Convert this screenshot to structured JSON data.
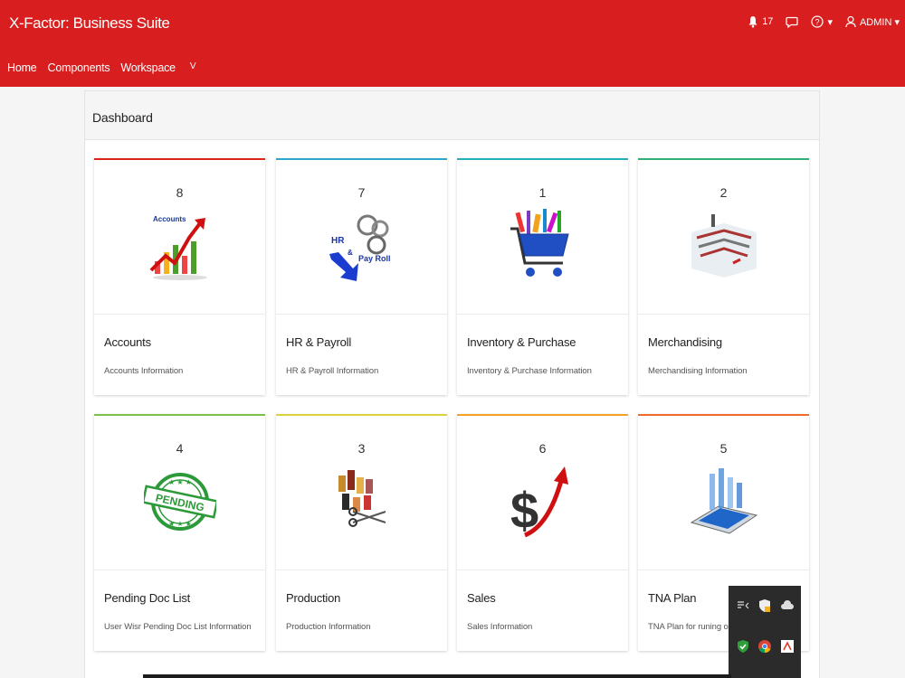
{
  "header": {
    "app_title": "X-Factor: Business Suite",
    "notif_count": "17",
    "user_label": "ADMIN ▾",
    "help_caret": "▾"
  },
  "nav": {
    "items": [
      "Home",
      "Components",
      "Workspace"
    ],
    "chevron": "V"
  },
  "panel": {
    "title": "Dashboard"
  },
  "cards": [
    {
      "count": "8",
      "title": "Accounts",
      "desc": "Accounts Information",
      "color": "#d9261c",
      "icon": "accounts-chart-icon",
      "icon_text": "Accounts"
    },
    {
      "count": "7",
      "title": "HR & Payroll",
      "desc": "HR & Payroll Information",
      "color": "#2aa8c8",
      "icon": "hr-payroll-icon",
      "icon_text": "HR & Pay Roll"
    },
    {
      "count": "1",
      "title": "Inventory & Purchase",
      "desc": "Inventory & Purchase Information",
      "color": "#1fb0b8",
      "icon": "shopping-cart-icon"
    },
    {
      "count": "2",
      "title": "Merchandising",
      "desc": "Merchandising Information",
      "color": "#2eb07a",
      "icon": "merchandising-icon"
    },
    {
      "count": "4",
      "title": "Pending Doc List",
      "desc": "User Wisr Pending Doc List Information",
      "color": "#7cc24a",
      "icon": "pending-stamp-icon",
      "icon_text": "PENDING"
    },
    {
      "count": "3",
      "title": "Production",
      "desc": "Production Information",
      "color": "#dcd23a",
      "icon": "production-thread-icon"
    },
    {
      "count": "6",
      "title": "Sales",
      "desc": "Sales Information",
      "color": "#f2a322",
      "icon": "sales-dollar-icon"
    },
    {
      "count": "5",
      "title": "TNA Plan",
      "desc": "TNA Plan for runing order",
      "color": "#f06a2a",
      "icon": "tna-plan-icon"
    }
  ]
}
